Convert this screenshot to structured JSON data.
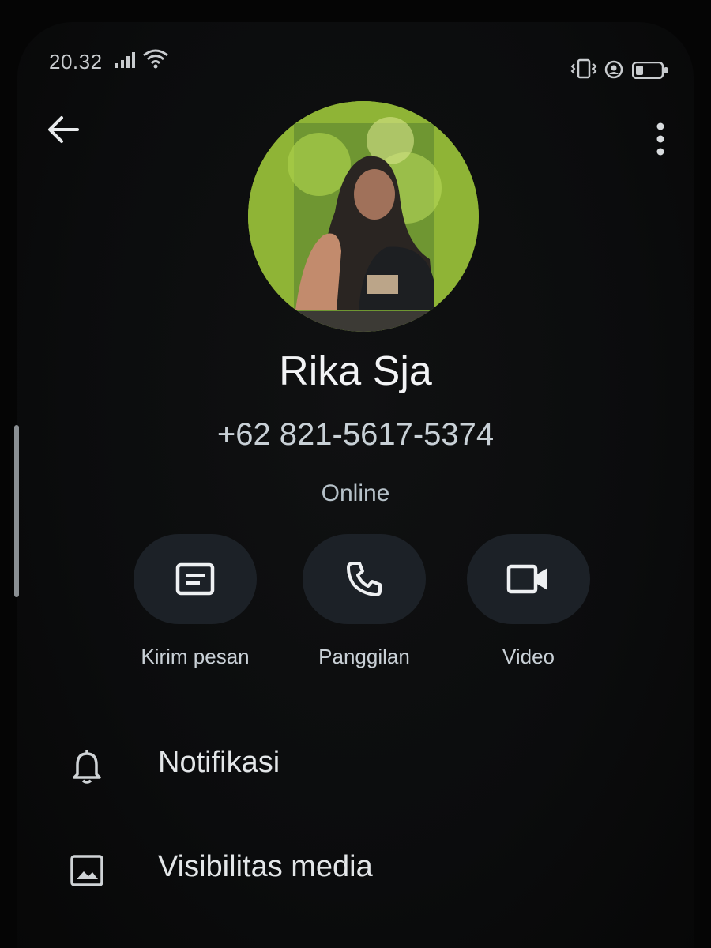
{
  "status_bar": {
    "time": "20.32",
    "icons": [
      "signal-icon",
      "wifi-icon",
      "vibrate-icon",
      "alarm-icon",
      "battery-icon"
    ]
  },
  "header": {
    "back_icon": "arrow-left-icon",
    "more_icon": "more-vertical-icon"
  },
  "contact": {
    "name": "Rika Sja",
    "phone": "+62 821-5617-5374",
    "status": "Online"
  },
  "actions": [
    {
      "label": "Kirim pesan",
      "icon": "message-icon"
    },
    {
      "label": "Panggilan",
      "icon": "phone-icon"
    },
    {
      "label": "Video",
      "icon": "video-icon"
    }
  ],
  "menu": [
    {
      "label": "Notifikasi",
      "icon": "bell-icon"
    },
    {
      "label": "Visibilitas media",
      "icon": "image-icon"
    }
  ],
  "colors": {
    "background": "#0b0c0d",
    "pill": "#1c2127",
    "text": "#e6e8ea"
  }
}
